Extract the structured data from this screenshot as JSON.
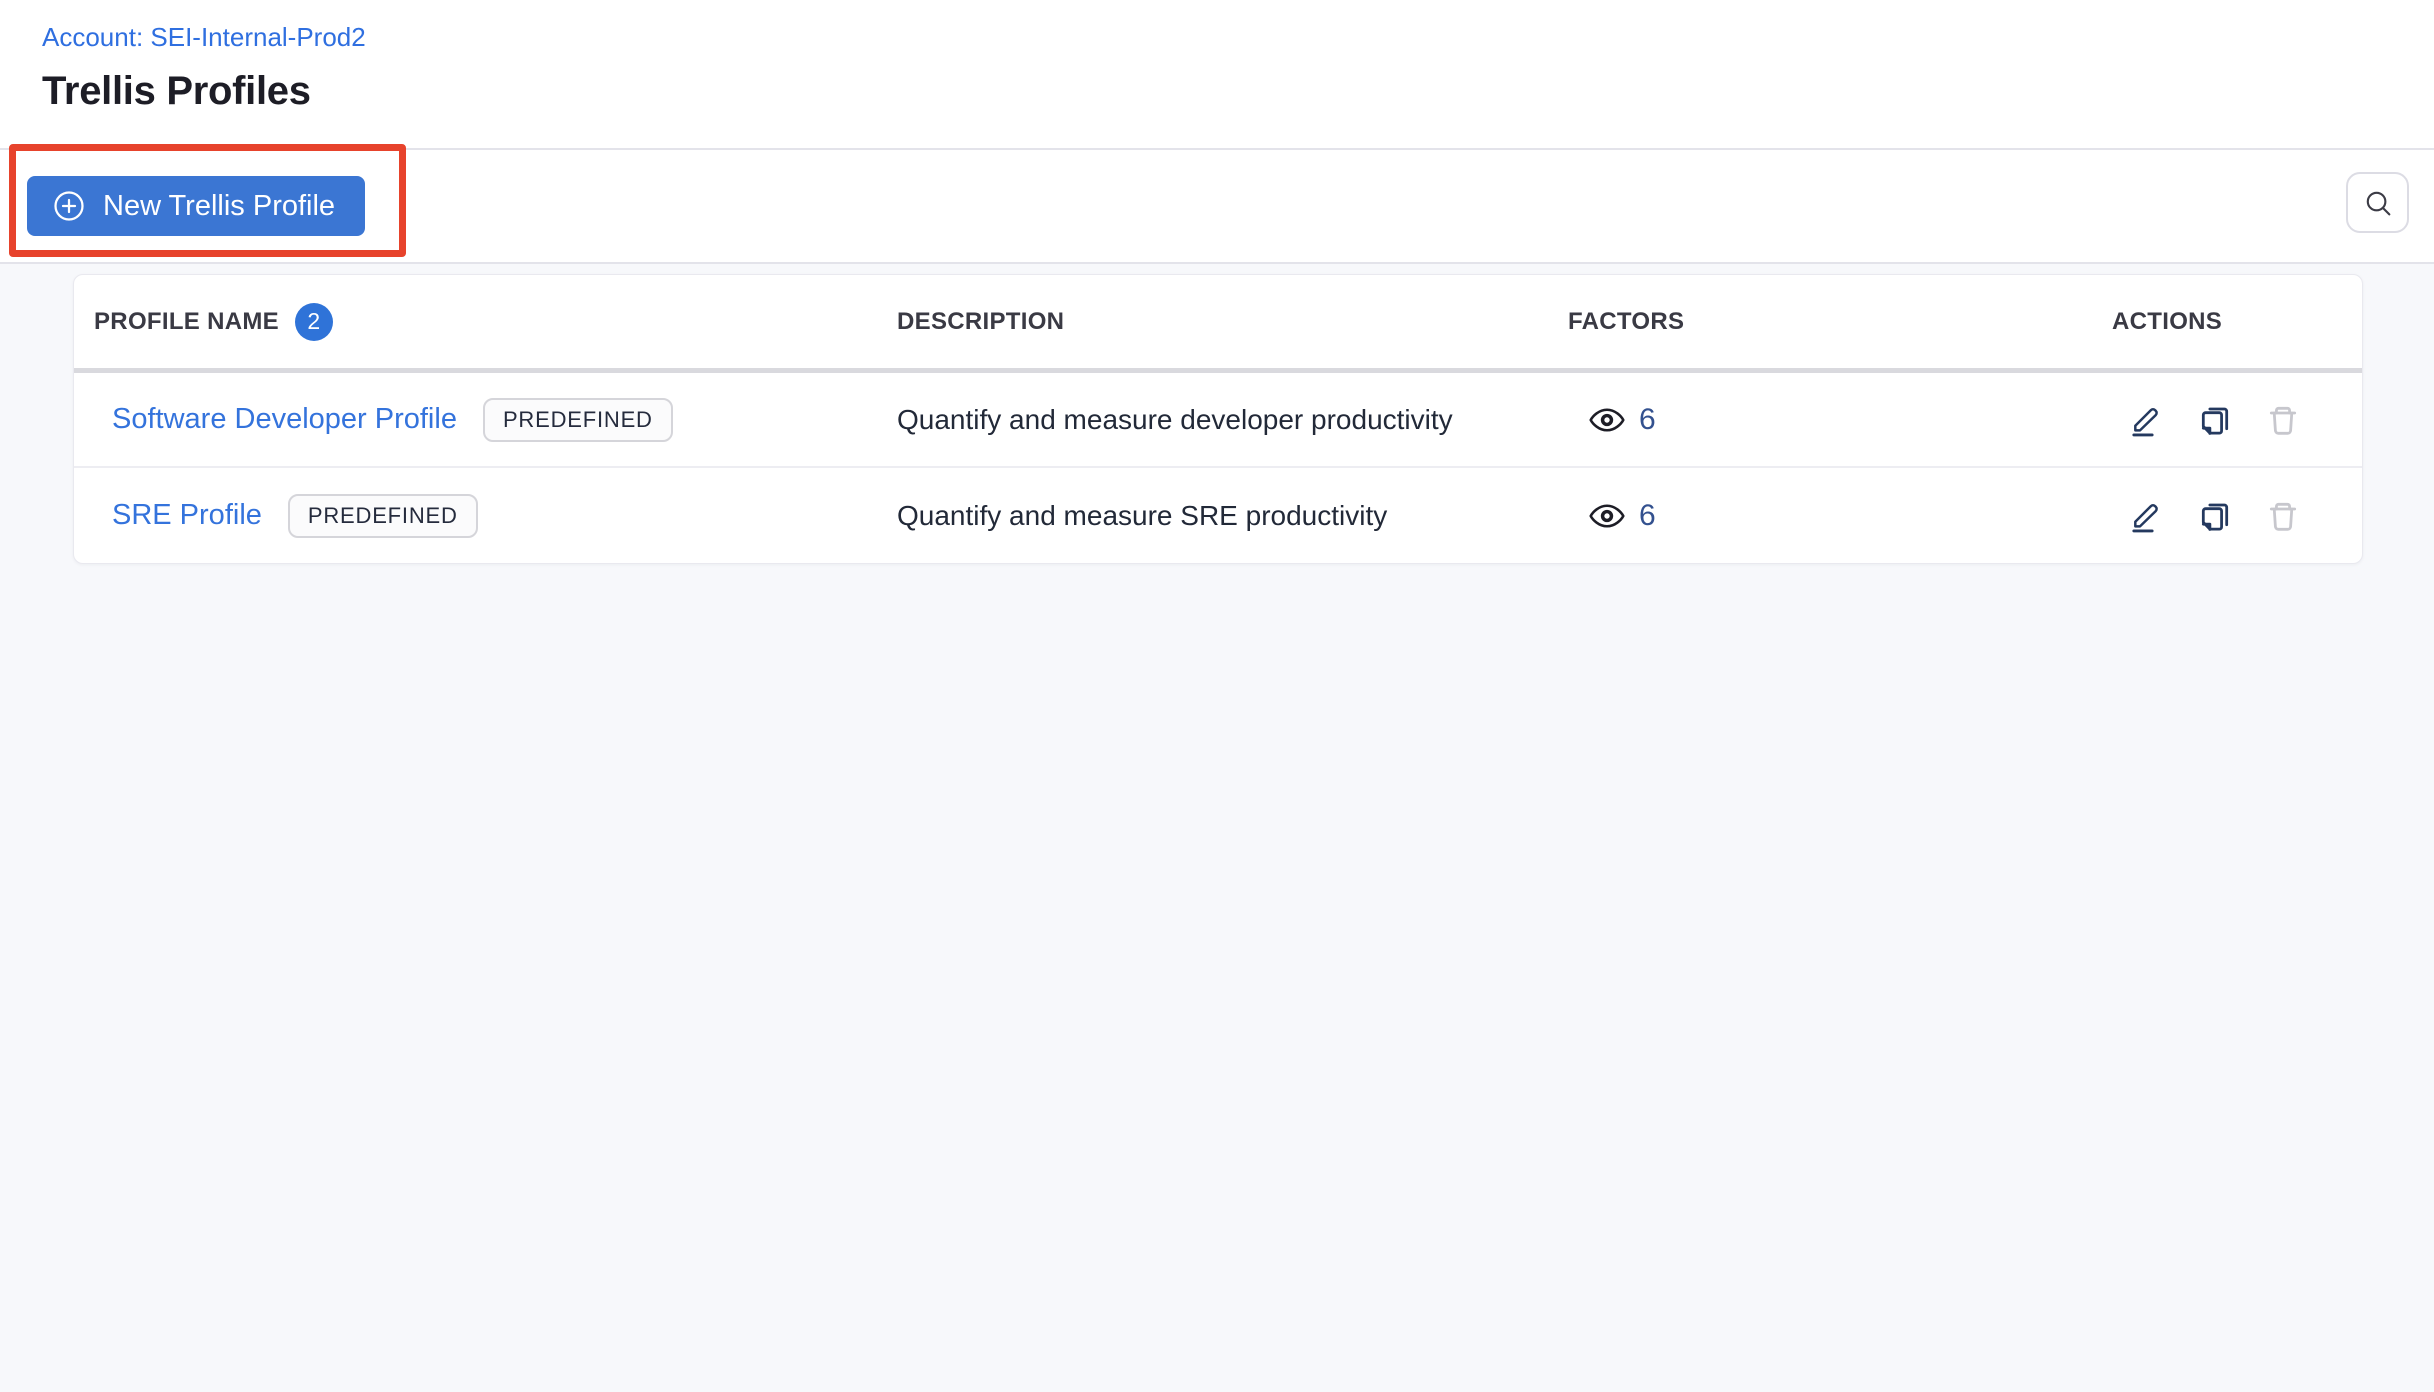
{
  "header": {
    "account": "Account: SEI-Internal-Prod2",
    "title": "Trellis Profiles"
  },
  "toolbar": {
    "new_profile_button": "New Trellis Profile"
  },
  "table": {
    "columns": [
      "PROFILE NAME",
      "DESCRIPTION",
      "FACTORS",
      "ACTIONS"
    ],
    "profile_count": "2",
    "rows": [
      {
        "name": "Software Developer Profile",
        "tag": "PREDEFINED",
        "description": "Quantify and measure developer productivity",
        "factors": "6"
      },
      {
        "name": "SRE Profile",
        "tag": "PREDEFINED",
        "description": "Quantify and measure SRE productivity",
        "factors": "6"
      }
    ]
  },
  "colors": {
    "primary_blue": "#3b76d3",
    "link_blue": "#3473dc",
    "count_badge_blue": "#2f73d8",
    "annotation_red": "#e7432c",
    "icon_navy": "#24395f",
    "disabled_gray": "#c7c7cd",
    "page_bg": "#f7f8fb",
    "header_text": "#3a3a44"
  }
}
